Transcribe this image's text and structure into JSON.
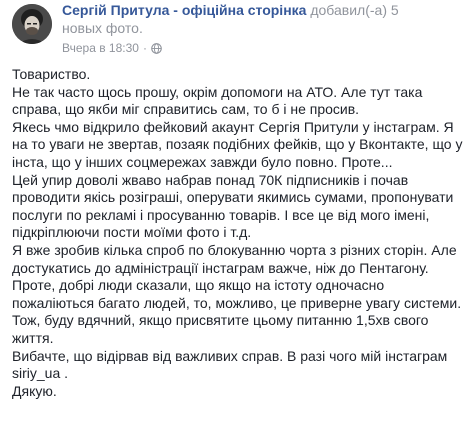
{
  "post": {
    "author_name": "Сергій Притула - офіційна сторінка",
    "action_line_1": "добавил(-а) 5",
    "action_line_2": "новых фото.",
    "timestamp": "Вчера в 18:30",
    "separator": "·",
    "privacy_icon": "globe-icon",
    "body_lines": [
      "Товариство.",
      "Не так часто щось прошу, окрім допомоги на АТО. Але тут така",
      "справа, що якби міг справитись сам, то б і не просив.",
      "Якесь чмо відкрило фейковий акаунт Сергія Притули у інстаграм. Я",
      "на то уваги не звертав, позаяк подібних фейків, що у Вконтакте, що у",
      "інста, що у інших соцмережах завжди було повно. Проте...",
      "Цей упир доволі жваво набрав понад 70К підписників і почав",
      "проводити якісь розіграші, оперувати якимись сумами, пропонувати",
      "послуги по рекламі і просуванню товарів. І все це від мого імені,",
      "підкріплюючи пости моїми фото і т.д.",
      "Я вже зробив кілька спроб по блокуванню чорта з різних сторін. Але",
      "достукатись до адміністрації інстаграм важче, ніж до Пентагону.",
      "Проте, добрі люди сказали, що якщо на істоту одночасно",
      "пожаліються багато людей, то, можливо, це приверне увагу системи.",
      "Тож, буду вдячний, якщо присвятите цьому питанню 1,5хв свого",
      "життя.",
      "Вибачте, що відірвав від важливих справ. В разі чого мій інстаграм",
      "siriy_ua .",
      "Дякую."
    ]
  },
  "colors": {
    "link": "#365899",
    "meta": "#90949c",
    "text": "#1d2129"
  }
}
